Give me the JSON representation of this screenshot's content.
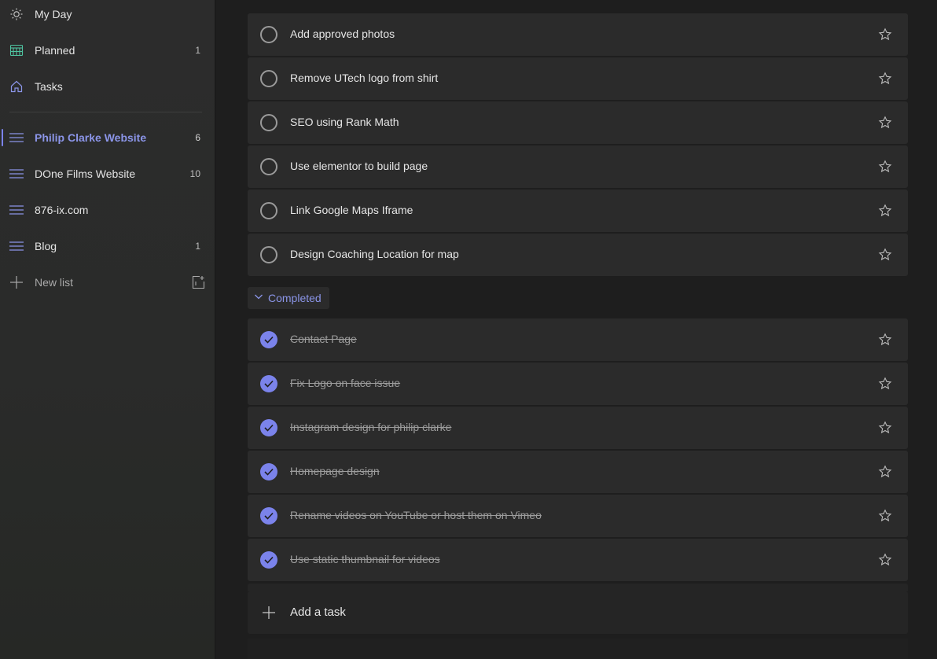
{
  "sidebar": {
    "items": [
      {
        "label": "My Day",
        "count": "",
        "icon": "sun-icon"
      },
      {
        "label": "Planned",
        "count": "1",
        "icon": "calendar-icon"
      },
      {
        "label": "Tasks",
        "count": "",
        "icon": "home-icon"
      }
    ],
    "lists": [
      {
        "label": "Philip Clarke Website",
        "count": "6",
        "icon": "list-icon",
        "active": true
      },
      {
        "label": "DOne Films Website",
        "count": "10",
        "icon": "list-icon"
      },
      {
        "label": "876-ix.com",
        "count": "",
        "icon": "list-icon"
      },
      {
        "label": "Blog",
        "count": "1",
        "icon": "list-icon"
      }
    ],
    "new_list": {
      "label": "New list",
      "icon": "plus-icon",
      "group_icon": "new-group-icon"
    }
  },
  "colors": {
    "accent": "#7b83eb",
    "sidebar_bg": "#2b2b2b",
    "task_bg": "#2b2b2b"
  },
  "tasks": [
    {
      "title": "Add approved photos"
    },
    {
      "title": "Remove UTech logo from shirt"
    },
    {
      "title": "SEO using Rank Math"
    },
    {
      "title": "Use elementor to build page"
    },
    {
      "title": "Link Google Maps Iframe"
    },
    {
      "title": "Design Coaching Location for map"
    }
  ],
  "completed": {
    "label": "Completed",
    "tasks": [
      {
        "title": "Contact Page"
      },
      {
        "title": "Fix Logo on face issue"
      },
      {
        "title": "Instagram design for philip clarke"
      },
      {
        "title": "Homepage design"
      },
      {
        "title": "Rename videos on YouTube or host them on Vimeo"
      },
      {
        "title": "Use static thumbnail for videos"
      }
    ]
  },
  "add_task": {
    "label": "Add a task"
  }
}
